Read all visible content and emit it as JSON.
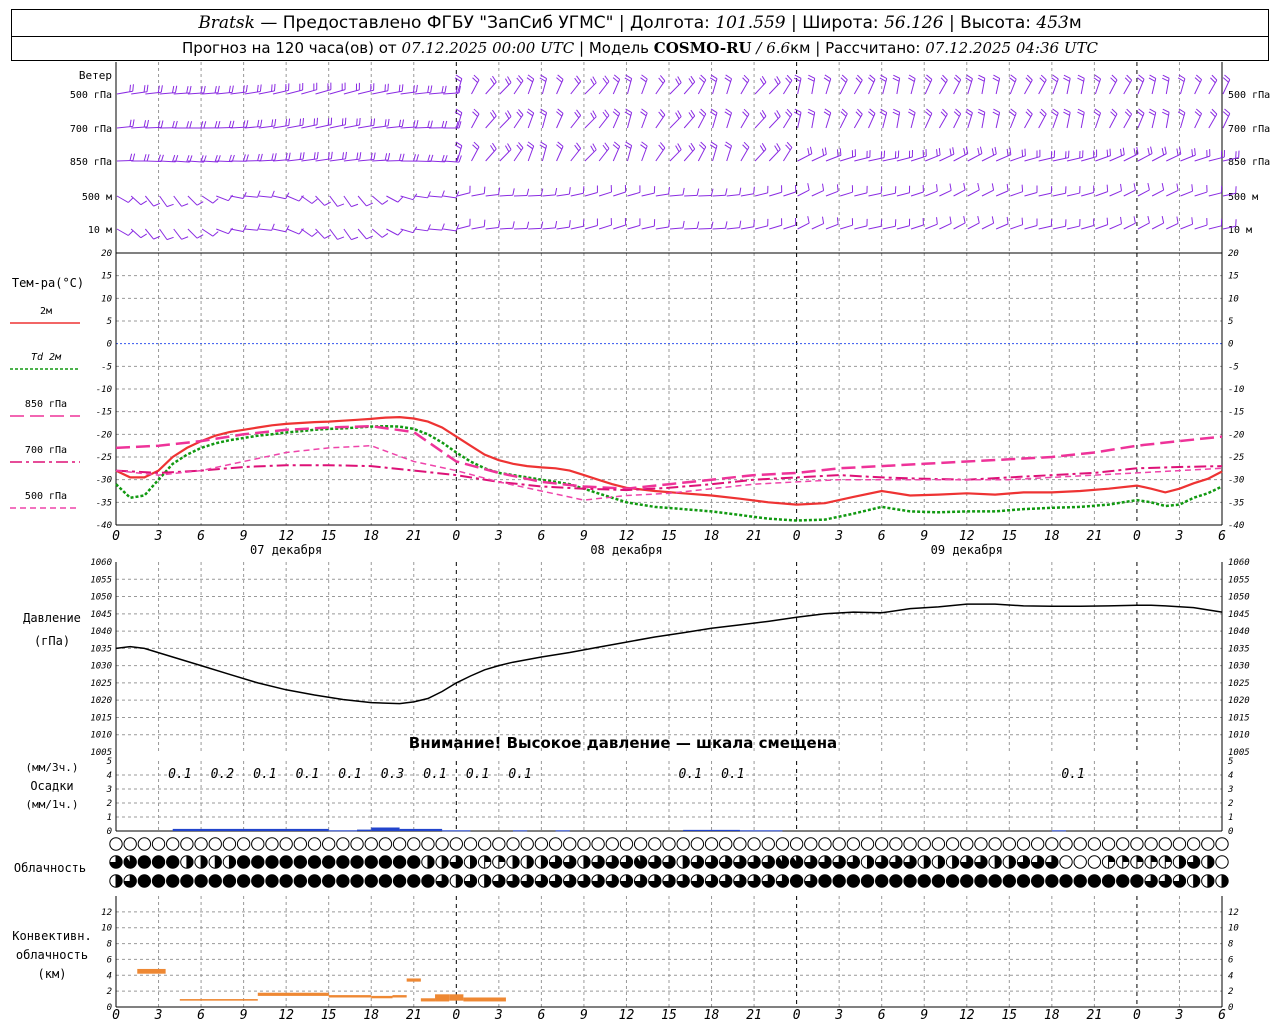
{
  "header": {
    "station": "Bratsk",
    "provided_by": "— Предоставлено ФГБУ \"ЗапСиб УГМС\"",
    "lon_label": "Долгота:",
    "lon_value": "101.559",
    "lat_label": "Широта:",
    "lat_value": "56.126",
    "alt_label": "Высота:",
    "alt_value": "453",
    "alt_unit": "м",
    "forecast_label": "Прогноз на 120 часа(ов) от",
    "forecast_time": "07.12.2025 00:00 UTC",
    "model_label": "Модель",
    "model_name": "COSMO-RU",
    "model_res": "/ 6.6",
    "model_res_unit": "км",
    "calc_label": "Рассчитано:",
    "calc_time": "07.12.2025 04:36 UTC"
  },
  "chart_data": {
    "type": "line",
    "hours": [
      0,
      3,
      6,
      9,
      12,
      15,
      18,
      21,
      24,
      27,
      30,
      33,
      36,
      39,
      42,
      45,
      48,
      51,
      54,
      57,
      60,
      63,
      66,
      69,
      72,
      75,
      78
    ],
    "x_tick_labels": [
      "0",
      "3",
      "6",
      "9",
      "12",
      "15",
      "18",
      "21",
      "0",
      "3",
      "6",
      "9",
      "12",
      "15",
      "18",
      "21",
      "0",
      "3",
      "6",
      "9",
      "12",
      "15",
      "18",
      "21",
      "0",
      "3",
      "6"
    ],
    "date_labels": [
      "07 декабря",
      "08 декабря",
      "09 декабря"
    ],
    "wind": {
      "title": "Ветер",
      "levels": [
        "500 гПа",
        "700 гПа",
        "850 гПа",
        "500 м",
        "10 м"
      ]
    },
    "temperature": {
      "title": "Тем-ра(°C)",
      "ylim": [
        -40,
        20
      ],
      "yticks": [
        20,
        15,
        10,
        5,
        0,
        -5,
        -10,
        -15,
        -20,
        -25,
        -30,
        -35,
        -40
      ],
      "series": [
        {
          "name": "2м",
          "color": "#ee3333",
          "x": [
            0,
            1,
            2,
            3,
            4,
            5,
            6,
            7,
            8,
            9,
            10,
            11,
            12,
            13,
            14,
            15,
            16,
            17,
            18,
            19,
            20,
            21,
            22,
            23,
            24,
            25,
            26,
            27,
            28,
            29,
            30,
            31,
            32,
            33,
            34,
            35,
            36,
            38,
            40,
            42,
            44,
            46,
            48,
            50,
            52,
            54,
            56,
            58,
            60,
            62,
            64,
            66,
            68,
            70,
            72,
            73,
            74,
            75,
            76,
            77,
            78
          ],
          "y": [
            -28,
            -29.5,
            -29.5,
            -28,
            -25,
            -23,
            -21.5,
            -20.3,
            -19.5,
            -19,
            -18.5,
            -18,
            -17.7,
            -17.5,
            -17.3,
            -17.2,
            -17,
            -16.8,
            -16.6,
            -16.3,
            -16.2,
            -16.5,
            -17.2,
            -18.5,
            -20.5,
            -22.5,
            -24.5,
            -25.7,
            -26.5,
            -27,
            -27.3,
            -27.5,
            -28,
            -29,
            -30,
            -31,
            -31.8,
            -32.5,
            -33,
            -33.5,
            -34.2,
            -35,
            -35.5,
            -35.2,
            -33.8,
            -32.5,
            -33.5,
            -33.3,
            -33,
            -33.3,
            -32.8,
            -32.8,
            -32.5,
            -32,
            -31.3,
            -32,
            -32.8,
            -32,
            -30.8,
            -29.8,
            -28.2
          ]
        },
        {
          "name": "Td 2м",
          "color": "#119911",
          "x": [
            0,
            1,
            2,
            3,
            4,
            5,
            6,
            7,
            8,
            9,
            10,
            11,
            12,
            13,
            14,
            15,
            16,
            17,
            18,
            19,
            20,
            21,
            22,
            23,
            24,
            25,
            26,
            27,
            28,
            29,
            30,
            31,
            32,
            33,
            34,
            35,
            36,
            38,
            40,
            42,
            44,
            46,
            48,
            50,
            52,
            54,
            56,
            58,
            60,
            62,
            64,
            66,
            68,
            70,
            72,
            73,
            74,
            75,
            76,
            77,
            78
          ],
          "y": [
            -31,
            -34,
            -33.5,
            -30,
            -26.5,
            -24.5,
            -23,
            -22,
            -21.3,
            -20.8,
            -20.3,
            -20,
            -19.6,
            -19.3,
            -19,
            -18.8,
            -18.7,
            -18.5,
            -18.3,
            -18.2,
            -18.3,
            -18.8,
            -20,
            -21.8,
            -24,
            -26,
            -27.5,
            -28.5,
            -29,
            -29.5,
            -30,
            -30.5,
            -31,
            -32,
            -33,
            -34,
            -35,
            -36,
            -36.5,
            -37,
            -37.8,
            -38.6,
            -39,
            -38.8,
            -37.5,
            -36,
            -37,
            -37.2,
            -37,
            -37,
            -36.5,
            -36.2,
            -36,
            -35.5,
            -34.5,
            -35,
            -35.8,
            -35.5,
            -34,
            -33,
            -31.5
          ]
        },
        {
          "name": "850 гПа",
          "color": "#ee3399",
          "x": [
            0,
            3,
            6,
            9,
            12,
            15,
            18,
            21,
            24,
            27,
            30,
            33,
            36,
            39,
            42,
            45,
            48,
            51,
            54,
            57,
            60,
            63,
            66,
            69,
            72,
            75,
            78
          ],
          "y": [
            -23,
            -22.5,
            -21.5,
            -20,
            -19,
            -18.5,
            -18.2,
            -19.5,
            -26,
            -28.5,
            -30.5,
            -31.5,
            -32,
            -31,
            -30,
            -29,
            -28.5,
            -27.5,
            -27,
            -26.5,
            -26,
            -25.5,
            -25,
            -24,
            -22.5,
            -21.5,
            -20.5
          ]
        },
        {
          "name": "700 гПа",
          "color": "#dd1177",
          "x": [
            0,
            3,
            6,
            9,
            12,
            15,
            18,
            21,
            24,
            27,
            30,
            33,
            36,
            39,
            42,
            45,
            48,
            51,
            54,
            57,
            60,
            63,
            66,
            69,
            72,
            75,
            78
          ],
          "y": [
            -28,
            -28.5,
            -28,
            -27.2,
            -26.8,
            -26.8,
            -27,
            -28,
            -29,
            -30.5,
            -31.5,
            -32,
            -32.3,
            -31.8,
            -31,
            -30,
            -29.5,
            -29,
            -29.5,
            -29.8,
            -30,
            -29.5,
            -29,
            -28.5,
            -27.5,
            -27.2,
            -27
          ]
        },
        {
          "name": "500 гПа",
          "color": "#ee44aa",
          "x": [
            0,
            3,
            6,
            9,
            12,
            15,
            18,
            21,
            24,
            27,
            30,
            33,
            36,
            39,
            42,
            45,
            48,
            51,
            54,
            57,
            60,
            63,
            66,
            69,
            72,
            75,
            78
          ],
          "y": [
            -28,
            -29,
            -28,
            -26,
            -24,
            -23,
            -22.5,
            -26,
            -28,
            -30.5,
            -32.5,
            -34.5,
            -33.5,
            -33,
            -32,
            -31,
            -30.5,
            -30,
            -30,
            -30,
            -30,
            -30,
            -29.5,
            -29,
            -28.5,
            -28,
            -27.5
          ]
        }
      ]
    },
    "pressure": {
      "title": "Давление",
      "unit": "(гПа)",
      "ylim": [
        1005,
        1060
      ],
      "yticks": [
        1060,
        1055,
        1050,
        1045,
        1040,
        1035,
        1030,
        1025,
        1020,
        1015,
        1010,
        1005
      ],
      "x": [
        0,
        1,
        2,
        4,
        6,
        8,
        10,
        12,
        14,
        16,
        18,
        20,
        21,
        22,
        23,
        24,
        25,
        26,
        27,
        28,
        30,
        32,
        34,
        36,
        38,
        40,
        42,
        44,
        46,
        48,
        50,
        52,
        54,
        56,
        58,
        60,
        62,
        64,
        66,
        68,
        70,
        72,
        73,
        74,
        76,
        78
      ],
      "values": [
        1035,
        1035.5,
        1035,
        1032.5,
        1030,
        1027.5,
        1025,
        1023,
        1021.5,
        1020.2,
        1019.3,
        1019,
        1019.5,
        1020.5,
        1022.5,
        1025,
        1027,
        1028.8,
        1030,
        1031,
        1032.5,
        1033.8,
        1035.3,
        1036.8,
        1038.3,
        1039.5,
        1040.8,
        1041.8,
        1042.8,
        1044,
        1045,
        1045.5,
        1045.3,
        1046.5,
        1047,
        1047.8,
        1047.8,
        1047.3,
        1047.2,
        1047.2,
        1047.3,
        1047.5,
        1047.5,
        1047.3,
        1046.8,
        1045.5
      ],
      "warning": "Внимание! Высокое давление — шкала смещена"
    },
    "precipitation": {
      "title": "Осадки",
      "unit_3h": "(мм/3ч.)",
      "unit_1h": "(мм/1ч.)",
      "ylim": [
        0,
        5
      ],
      "labels": [
        {
          "hour": 4.5,
          "text": "0.1"
        },
        {
          "hour": 7.5,
          "text": "0.2"
        },
        {
          "hour": 10.5,
          "text": "0.1"
        },
        {
          "hour": 13.5,
          "text": "0.1"
        },
        {
          "hour": 16.5,
          "text": "0.1"
        },
        {
          "hour": 19.5,
          "text": "0.3"
        },
        {
          "hour": 22.5,
          "text": "0.1"
        },
        {
          "hour": 25.5,
          "text": "0.1"
        },
        {
          "hour": 28.5,
          "text": "0.1"
        },
        {
          "hour": 40.5,
          "text": "0.1"
        },
        {
          "hour": 43.5,
          "text": "0.1"
        },
        {
          "hour": 67.5,
          "text": "0.1"
        }
      ],
      "bars": [
        {
          "from": 4,
          "to": 15,
          "value": 0.15
        },
        {
          "from": 15,
          "to": 17,
          "value": 0.05
        },
        {
          "from": 17,
          "to": 18,
          "value": 0.1
        },
        {
          "from": 18,
          "to": 20,
          "value": 0.25
        },
        {
          "from": 20,
          "to": 23,
          "value": 0.15
        },
        {
          "from": 23,
          "to": 25,
          "value": 0.05
        },
        {
          "from": 28,
          "to": 29,
          "value": 0.05
        },
        {
          "from": 31,
          "to": 32,
          "value": 0.05
        },
        {
          "from": 40,
          "to": 44,
          "value": 0.08
        },
        {
          "from": 44,
          "to": 47,
          "value": 0.05
        },
        {
          "from": 66,
          "to": 67,
          "value": 0.05
        }
      ]
    },
    "cloudiness": {
      "title": "Облачность",
      "row_top_fraction": [
        0,
        0,
        0,
        0,
        0,
        0,
        0,
        0,
        0,
        0,
        0,
        0,
        0,
        0,
        0,
        0,
        0,
        0,
        0,
        0,
        0,
        0,
        0,
        0,
        0,
        0,
        0,
        0,
        0,
        0,
        0,
        0,
        0,
        0,
        0,
        0,
        0,
        0,
        0,
        0,
        0,
        0,
        0,
        0,
        0,
        0,
        0,
        0,
        0,
        0,
        0,
        0,
        0,
        0,
        0,
        0,
        0,
        0,
        0,
        0,
        0,
        0,
        0,
        0,
        0,
        0,
        0,
        0,
        0,
        0,
        0,
        0,
        0,
        0,
        0,
        0,
        0,
        0,
        0
      ],
      "row_mid_fraction": [
        0.75,
        0.9,
        1,
        1,
        1,
        0.5,
        0.5,
        0.5,
        0.5,
        1,
        1,
        1,
        1,
        1,
        1,
        1,
        1,
        1,
        1,
        1,
        1,
        1,
        0.5,
        0.5,
        0.75,
        0.5,
        0.25,
        0.25,
        0.5,
        0.5,
        0.5,
        0.75,
        0.75,
        0.5,
        0.75,
        0.75,
        0.75,
        0.9,
        0.75,
        0.75,
        0.5,
        0.75,
        0.75,
        0.75,
        0.75,
        0.75,
        0.75,
        0.9,
        0.9,
        0.75,
        0.75,
        0.75,
        0.75,
        0.5,
        0.75,
        0.75,
        0.75,
        0.5,
        0.5,
        0.5,
        0.75,
        0.75,
        0.5,
        0.5,
        0.75,
        0.75,
        0.75,
        0,
        0,
        0,
        0.25,
        0.25,
        0.25,
        0.25,
        0.25,
        0.5,
        0.75,
        0.5,
        0
      ],
      "row_low_fraction": [
        0.5,
        0.75,
        1,
        1,
        1,
        1,
        1,
        1,
        1,
        1,
        1,
        1,
        1,
        1,
        1,
        1,
        1,
        1,
        1,
        1,
        1,
        1,
        1,
        0.75,
        0.5,
        0.75,
        0.5,
        0.75,
        0.75,
        0.75,
        0.75,
        0.75,
        0.75,
        0.75,
        0.75,
        0.75,
        0.75,
        0.75,
        0.75,
        0.75,
        0.75,
        0.75,
        0.75,
        0.75,
        0.75,
        0.75,
        0.75,
        0.75,
        1,
        0.75,
        1,
        1,
        1,
        1,
        1,
        1,
        1,
        1,
        1,
        1,
        1,
        1,
        1,
        1,
        1,
        1,
        1,
        1,
        1,
        1,
        1,
        1,
        1,
        0.75,
        0.75,
        0.75,
        0.5,
        0.5,
        0.5
      ]
    },
    "convective": {
      "title_line1": "Конвективн.",
      "title_line2": "облачность",
      "unit": "(км)",
      "ylim": [
        0,
        14
      ],
      "yticks": [
        12,
        10,
        8,
        6,
        4,
        2,
        0
      ],
      "segments": [
        {
          "from": 1.5,
          "to": 3.5,
          "bottom": 4.2,
          "top": 4.8
        },
        {
          "from": 4.5,
          "to": 10,
          "bottom": 0.8,
          "top": 1
        },
        {
          "from": 10,
          "to": 15,
          "bottom": 1.4,
          "top": 1.8
        },
        {
          "from": 15,
          "to": 18,
          "bottom": 1.2,
          "top": 1.5
        },
        {
          "from": 18,
          "to": 19.5,
          "bottom": 1.1,
          "top": 1.4
        },
        {
          "from": 19.5,
          "to": 20.5,
          "bottom": 1.2,
          "top": 1.5
        },
        {
          "from": 20.5,
          "to": 21.5,
          "bottom": 3.2,
          "top": 3.6
        },
        {
          "from": 21.5,
          "to": 22.5,
          "bottom": 0.7,
          "top": 1.1
        },
        {
          "from": 22.5,
          "to": 23.5,
          "bottom": 0.7,
          "top": 1.6
        },
        {
          "from": 23.5,
          "to": 24.5,
          "bottom": 0.8,
          "top": 1.6
        },
        {
          "from": 24.5,
          "to": 27.5,
          "bottom": 0.7,
          "top": 1.2
        }
      ]
    }
  },
  "colors": {
    "wind_barb": "#8a2be2",
    "precip_bar": "#2244cc",
    "convective_bar": "#ee8833",
    "zero_line": "#3355ee",
    "grid": "#999999"
  }
}
